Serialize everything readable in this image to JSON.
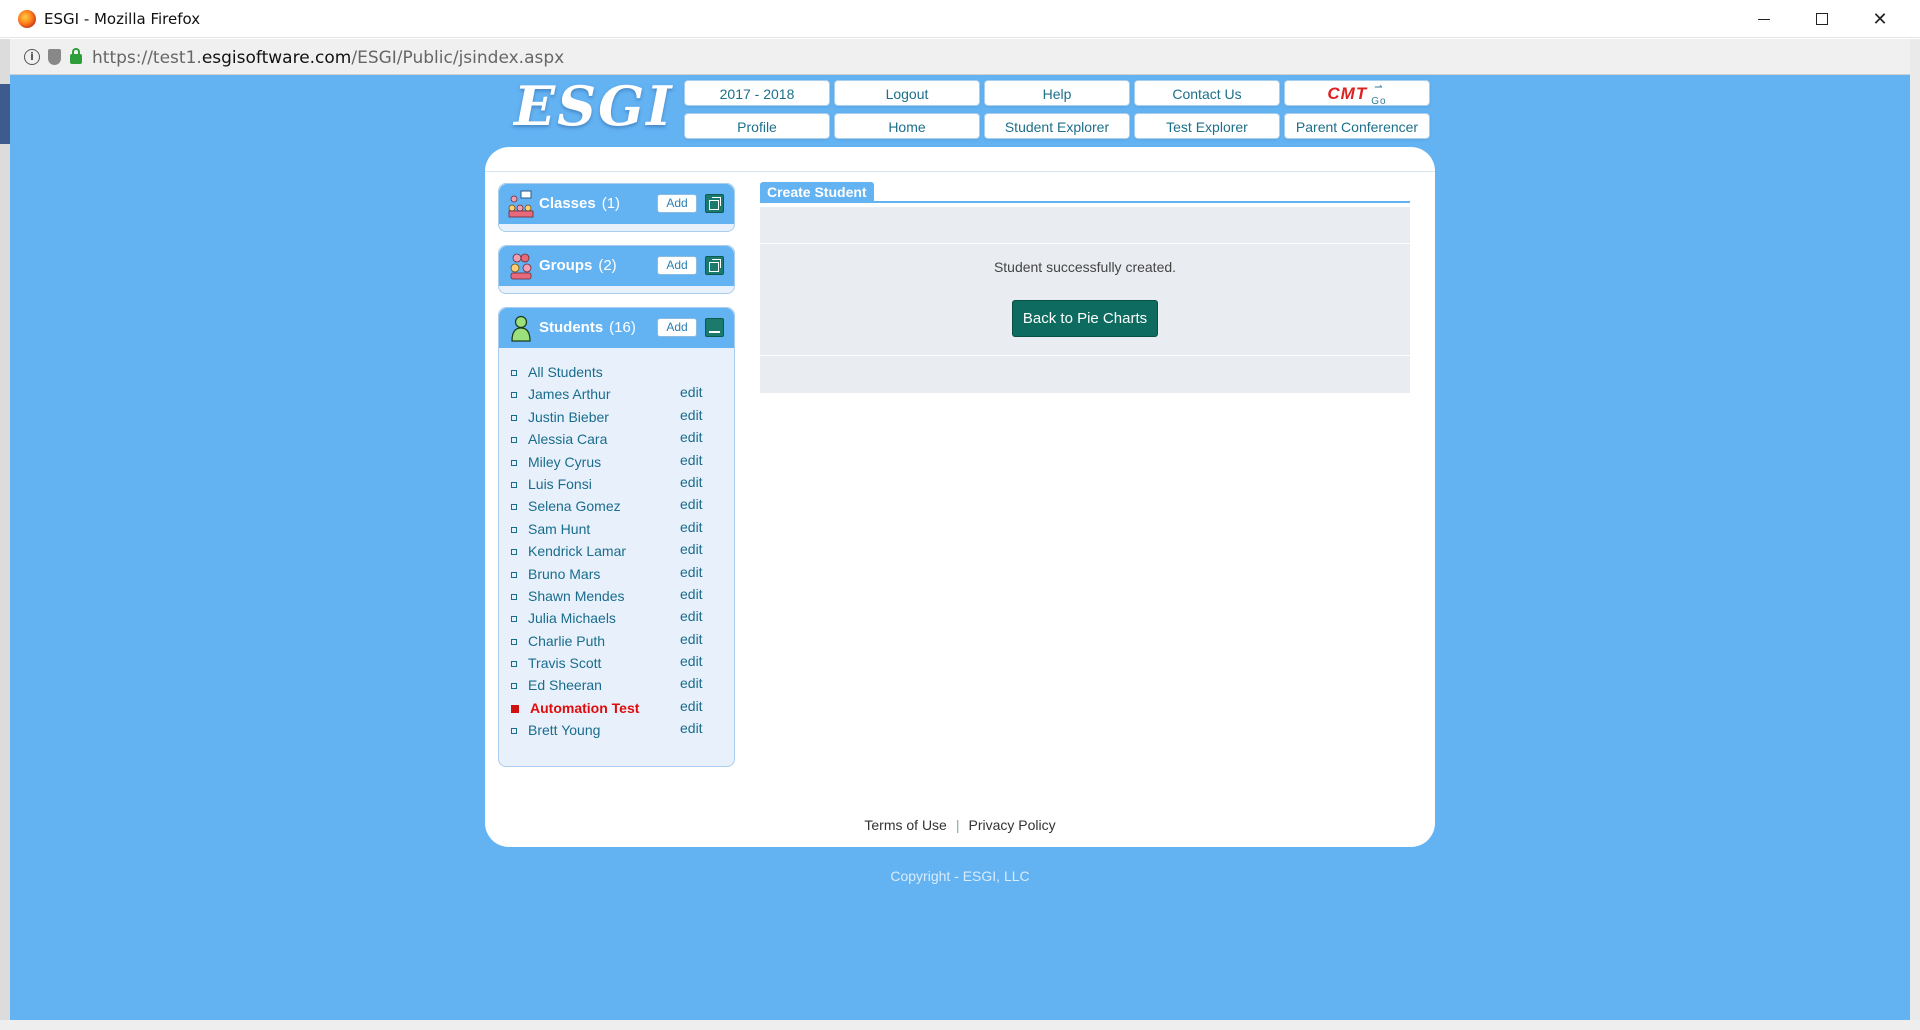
{
  "window": {
    "title": "ESGI - Mozilla Firefox"
  },
  "browser": {
    "url_prefix": "https://test1.",
    "url_domain": "esgisoftware.com",
    "url_path": "/ESGI/Public/jsindex.aspx"
  },
  "logo": {
    "text": "ESGI"
  },
  "topnav": {
    "row1": [
      "2017 - 2018",
      "Logout",
      "Help",
      "Contact Us"
    ],
    "cmt_label": "CMT",
    "cmt_go": "Go",
    "row2": [
      "Profile",
      "Home",
      "Student Explorer",
      "Test Explorer",
      "Parent Conferencer"
    ]
  },
  "sidebar": {
    "classes": {
      "label": "Classes",
      "count": "(1)",
      "add_label": "Add"
    },
    "groups": {
      "label": "Groups",
      "count": "(2)",
      "add_label": "Add"
    },
    "students": {
      "label": "Students",
      "count": "(16)",
      "add_label": "Add",
      "edit_label": "edit",
      "items": [
        {
          "name": "All Students"
        },
        {
          "name": "James Arthur"
        },
        {
          "name": "Justin Bieber"
        },
        {
          "name": "Alessia Cara"
        },
        {
          "name": "Miley Cyrus"
        },
        {
          "name": "Luis Fonsi"
        },
        {
          "name": "Selena Gomez"
        },
        {
          "name": "Sam Hunt"
        },
        {
          "name": "Kendrick Lamar"
        },
        {
          "name": "Bruno Mars"
        },
        {
          "name": "Shawn Mendes"
        },
        {
          "name": "Julia Michaels"
        },
        {
          "name": "Charlie Puth"
        },
        {
          "name": "Travis Scott"
        },
        {
          "name": "Ed Sheeran"
        },
        {
          "name": "Automation Test",
          "active": true
        },
        {
          "name": "Brett Young"
        }
      ]
    }
  },
  "main": {
    "tab_label": "Create Student",
    "message": "Student successfully created.",
    "back_button": "Back to Pie Charts"
  },
  "footer": {
    "terms": "Terms of Use",
    "separator": "|",
    "privacy": "Privacy Policy",
    "copyright": "Copyright - ESGI, LLC"
  },
  "colors": {
    "page_bg": "#63b2f2",
    "accent_teal": "#0e6b5f",
    "active_student": "#e00b0b",
    "link": "#1a6c8c"
  }
}
